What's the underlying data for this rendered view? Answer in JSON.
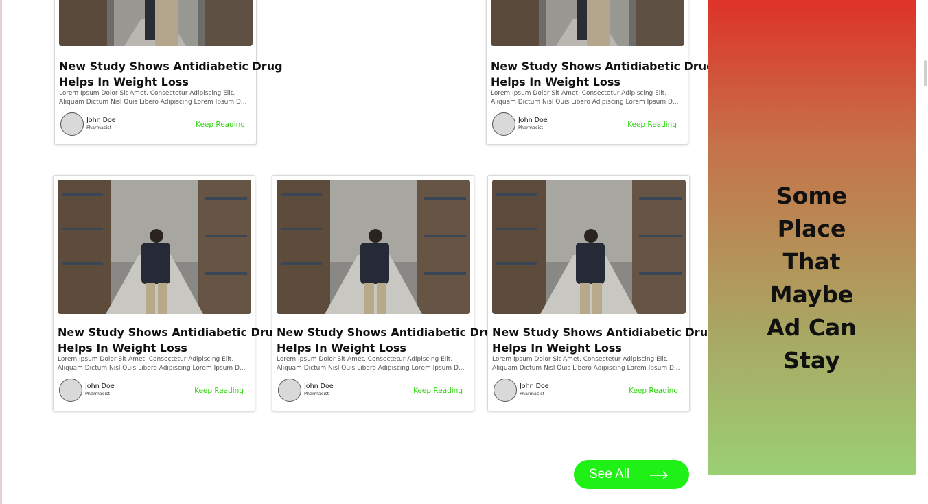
{
  "colors": {
    "accent": "#1ff016",
    "keep_reading": "#2ed60e",
    "ad_top": "#de3327",
    "ad_bottom": "#9bcf74"
  },
  "article_title_line1": "New Study Shows Antidiabetic Drug",
  "article_title_line2": "Helps In Weight Loss",
  "article_desc_line1": "Lorem Ipsum Dolor Sit Amet, Consectetur Adipiscing Elit.",
  "article_desc_line2": "Aliquam Dictum Nisl Quis Libero Adipiscing Lorem Ipsum D...",
  "author_name": "John Doe",
  "author_role": "Pharmacist",
  "keep_reading_label": "Keep Reading",
  "image_icon": "warehouse-photo",
  "see_all": {
    "label": "See All",
    "icon": "arrow-right-icon"
  },
  "ad": {
    "line1": "Some",
    "line2": "Place",
    "line3": "That",
    "line4": "Maybe",
    "line5": "Ad Can",
    "line6": "Stay"
  }
}
